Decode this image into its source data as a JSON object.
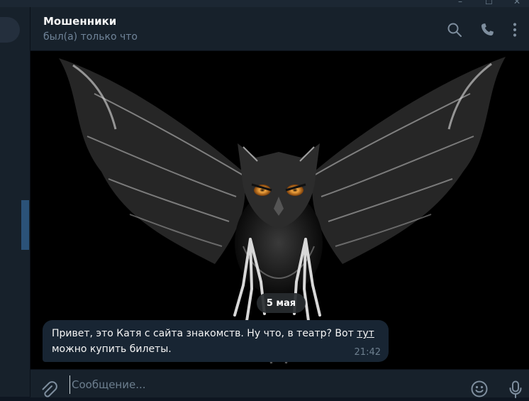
{
  "window": {
    "minimize_glyph": "–",
    "maximize_glyph": "☐",
    "close_glyph": "✕"
  },
  "chat": {
    "title": "Мошенники",
    "status": "был(а) только что"
  },
  "header_icons": [
    "search-icon",
    "phone-icon",
    "more-vertical-icon"
  ],
  "date_separator": "5 мая",
  "message": {
    "text_before_link": "Привет, это Катя с сайта знакомств. Ну что, в театр? Вот ",
    "link_text": "тут",
    "text_after_link": " можно купить билеты.",
    "time": "21:42"
  },
  "composer": {
    "placeholder": "Сообщение...",
    "value": ""
  },
  "composer_icons": [
    "attach-icon",
    "emoji-icon",
    "microphone-icon"
  ],
  "colors": {
    "background": "#0e1621",
    "panel": "#17212b",
    "bubble": "#182533",
    "accent": "#2b5278",
    "muted_text": "#708499",
    "owl_eyes": "#e3902e"
  }
}
